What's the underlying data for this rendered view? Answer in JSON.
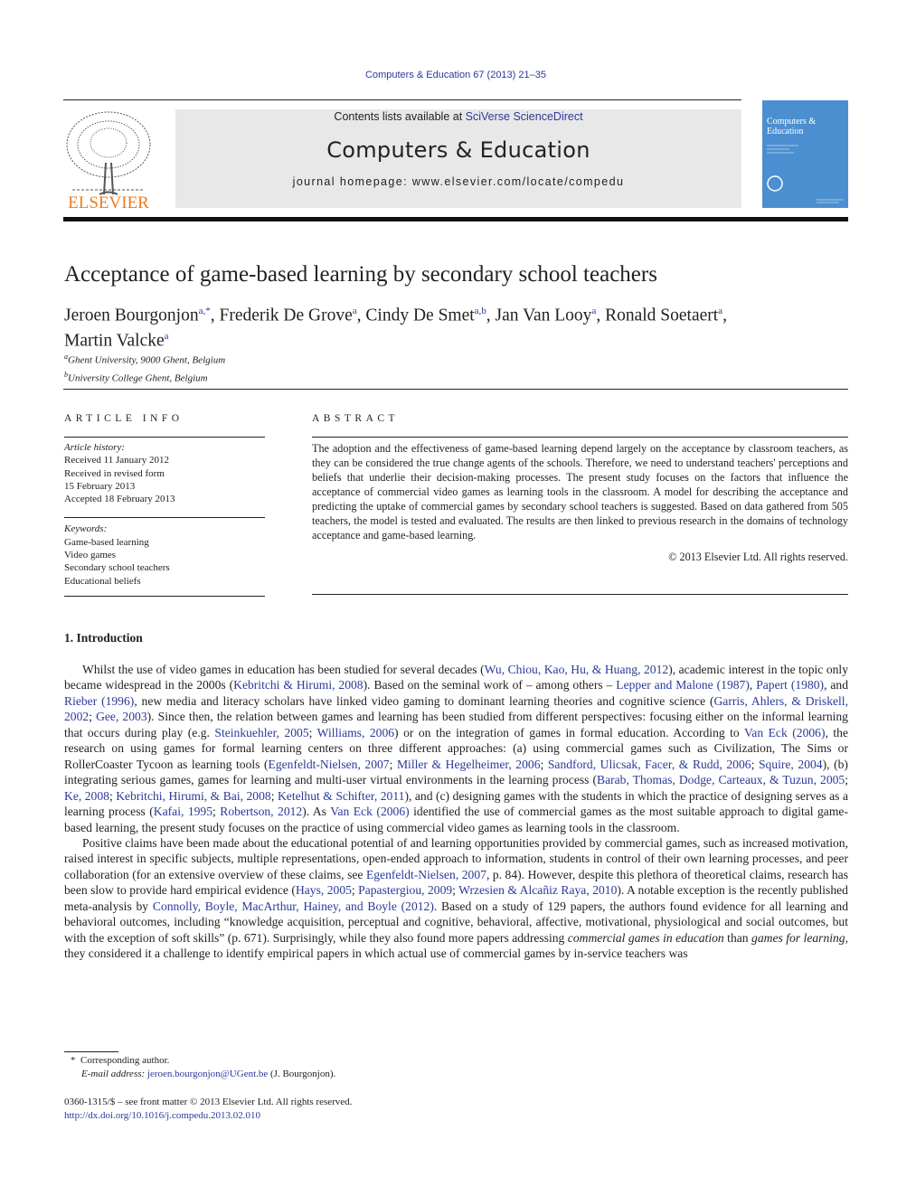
{
  "header": {
    "citation": "Computers & Education 67 (2013) 21–35",
    "contents_prefix": "Contents lists available at ",
    "contents_link": "SciVerse ScienceDirect",
    "journal_title": "Computers & Education",
    "homepage_prefix": "journal homepage: ",
    "homepage_url": "www.elsevier.com/locate/compedu",
    "publisher_logo": "ELSEVIER",
    "cover_title": "Computers & Education"
  },
  "article": {
    "title": "Acceptance of game-based learning by secondary school teachers",
    "authors": [
      {
        "name": "Jeroen Bourgonjon",
        "sup": "a,*"
      },
      {
        "name": "Frederik De Grove",
        "sup": "a"
      },
      {
        "name": "Cindy De Smet",
        "sup": "a,b"
      },
      {
        "name": "Jan Van Looy",
        "sup": "a"
      },
      {
        "name": "Ronald Soetaert",
        "sup": "a"
      },
      {
        "name": "Martin Valcke",
        "sup": "a"
      }
    ],
    "affiliations": [
      {
        "sup": "a",
        "text": "Ghent University, 9000 Ghent, Belgium"
      },
      {
        "sup": "b",
        "text": "University College Ghent, Belgium"
      }
    ]
  },
  "article_info": {
    "heading": "ARTICLE INFO",
    "history_label": "Article history:",
    "history": [
      "Received 11 January 2012",
      "Received in revised form",
      "15 February 2013",
      "Accepted 18 February 2013"
    ],
    "keywords_label": "Keywords:",
    "keywords": [
      "Game-based learning",
      "Video games",
      "Secondary school teachers",
      "Educational beliefs"
    ]
  },
  "abstract": {
    "heading": "ABSTRACT",
    "text": "The adoption and the effectiveness of game-based learning depend largely on the acceptance by classroom teachers, as they can be considered the true change agents of the schools. Therefore, we need to understand teachers' perceptions and beliefs that underlie their decision-making processes. The present study focuses on the factors that influence the acceptance of commercial video games as learning tools in the classroom. A model for describing the acceptance and predicting the uptake of commercial games by secondary school teachers is suggested. Based on data gathered from 505 teachers, the model is tested and evaluated. The results are then linked to previous research in the domains of technology acceptance and game-based learning.",
    "copyright": "© 2013 Elsevier Ltd. All rights reserved."
  },
  "body": {
    "section_heading": "1.  Introduction",
    "paragraphs": [
      [
        {
          "t": "Whilst the use of video games in education has been studied for several decades ("
        },
        {
          "t": "Wu, Chiou, Kao, Hu, & Huang, 2012",
          "l": 1
        },
        {
          "t": "), academic interest in the topic only became widespread in the 2000s ("
        },
        {
          "t": "Kebritchi & Hirumi, 2008",
          "l": 1
        },
        {
          "t": "). Based on the seminal work of – among others – "
        },
        {
          "t": "Lepper and Malone (1987)",
          "l": 1
        },
        {
          "t": ", "
        },
        {
          "t": "Papert (1980)",
          "l": 1
        },
        {
          "t": ", and "
        },
        {
          "t": "Rieber (1996)",
          "l": 1
        },
        {
          "t": ", new media and literacy scholars have linked video gaming to dominant learning theories and cognitive science ("
        },
        {
          "t": "Garris, Ahlers, & Driskell, 2002",
          "l": 1
        },
        {
          "t": "; "
        },
        {
          "t": "Gee, 2003",
          "l": 1
        },
        {
          "t": "). Since then, the relation between games and learning has been studied from different perspectives: focusing either on the informal learning that occurs during play (e.g. "
        },
        {
          "t": "Steinkuehler, 2005",
          "l": 1
        },
        {
          "t": "; "
        },
        {
          "t": "Williams, 2006",
          "l": 1
        },
        {
          "t": ") or on the integration of games in formal education. According to "
        },
        {
          "t": "Van Eck (2006)",
          "l": 1
        },
        {
          "t": ", the research on using games for formal learning centers on three different approaches: (a) using commercial games such as Civilization, The Sims or RollerCoaster Tycoon as learning tools ("
        },
        {
          "t": "Egenfeldt-Nielsen, 2007",
          "l": 1
        },
        {
          "t": "; "
        },
        {
          "t": "Miller & Hegelheimer, 2006",
          "l": 1
        },
        {
          "t": "; "
        },
        {
          "t": "Sandford, Ulicsak, Facer, & Rudd, 2006",
          "l": 1
        },
        {
          "t": "; "
        },
        {
          "t": "Squire, 2004",
          "l": 1
        },
        {
          "t": "), (b) integrating serious games, games for learning and multi-user virtual environments in the learning process ("
        },
        {
          "t": "Barab, Thomas, Dodge, Carteaux, & Tuzun, 2005",
          "l": 1
        },
        {
          "t": "; "
        },
        {
          "t": "Ke, 2008",
          "l": 1
        },
        {
          "t": "; "
        },
        {
          "t": "Kebritchi, Hirumi, & Bai, 2008",
          "l": 1
        },
        {
          "t": "; "
        },
        {
          "t": "Ketelhut & Schifter, 2011",
          "l": 1
        },
        {
          "t": "), and (c) designing games with the students in which the practice of designing serves as a learning process ("
        },
        {
          "t": "Kafai, 1995",
          "l": 1
        },
        {
          "t": "; "
        },
        {
          "t": "Robertson, 2012",
          "l": 1
        },
        {
          "t": "). As "
        },
        {
          "t": "Van Eck (2006)",
          "l": 1
        },
        {
          "t": " identified the use of commercial games as the most suitable approach to digital game-based learning, the present study focuses on the practice of using commercial video games as learning tools in the classroom."
        }
      ],
      [
        {
          "t": "Positive claims have been made about the educational potential of and learning opportunities provided by commercial games, such as increased motivation, raised interest in specific subjects, multiple representations, open-ended approach to information, students in control of their own learning processes, and peer collaboration (for an extensive overview of these claims, see "
        },
        {
          "t": "Egenfeldt-Nielsen, 2007",
          "l": 1
        },
        {
          "t": ", p. 84). However, despite this plethora of theoretical claims, research has been slow to provide hard empirical evidence ("
        },
        {
          "t": "Hays, 2005",
          "l": 1
        },
        {
          "t": "; "
        },
        {
          "t": "Papastergiou, 2009",
          "l": 1
        },
        {
          "t": "; "
        },
        {
          "t": "Wrzesien & Alcañiz Raya, 2010",
          "l": 1
        },
        {
          "t": "). A notable exception is the recently published meta-analysis by "
        },
        {
          "t": "Connolly, Boyle, MacArthur, Hainey, and Boyle (2012)",
          "l": 1
        },
        {
          "t": ". Based on a study of 129 papers, the authors found evidence for all learning and behavioral outcomes, including “knowledge acquisition, perceptual and cognitive, behavioral, affective, motivational, physiological and social outcomes, but with the exception of soft skills” (p. 671). Surprisingly, while they also found more papers addressing "
        },
        {
          "t": "commercial games in education",
          "i": 1
        },
        {
          "t": " than "
        },
        {
          "t": "games for learning",
          "i": 1
        },
        {
          "t": ", they considered it a challenge to identify empirical papers in which actual use of commercial games by in-service teachers was"
        }
      ]
    ]
  },
  "footnote": {
    "marker": "*",
    "corresponding": "Corresponding author.",
    "email_label": "E-mail address: ",
    "email": "jeroen.bourgonjon@UGent.be",
    "email_suffix": " (J. Bourgonjon)."
  },
  "front_matter": {
    "issn": "0360-1315/$ – see front matter © 2013 Elsevier Ltd. All rights reserved.",
    "doi": "http://dx.doi.org/10.1016/j.compedu.2013.02.010"
  },
  "colors": {
    "link": "#2a3a9a",
    "elsevier_orange": "#f07b1d",
    "cover_blue": "#4b8fd0",
    "banner_gray": "#e8e8e8"
  }
}
